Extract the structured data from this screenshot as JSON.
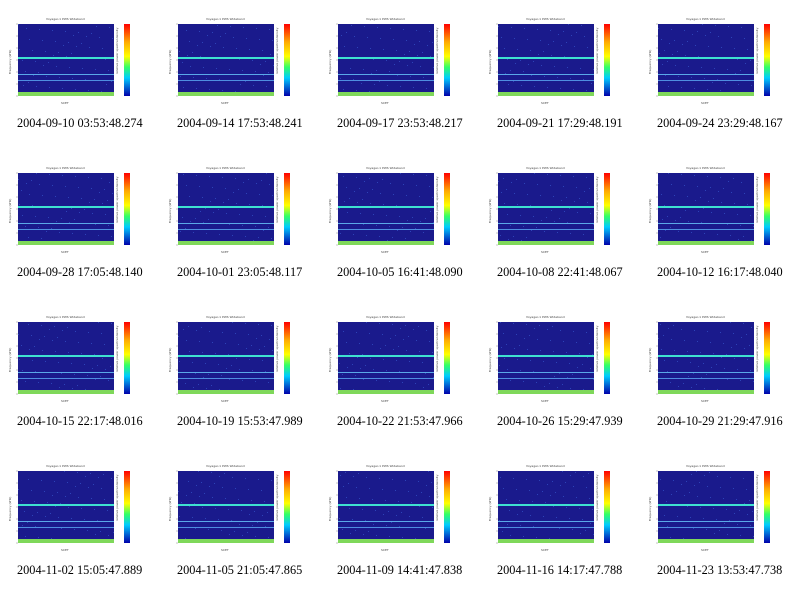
{
  "gallery": {
    "plot_title_template": "Voyager-1 PWS Wideband",
    "ylabel": "Frequency (kHz)",
    "colorbar_label": "relative power spectral density",
    "xaxis_units": "SCET",
    "colors": {
      "plot_background": "#1a1a8c",
      "band_cyan": "#3fe0d0",
      "floor_green": "#7fd85a",
      "colorbar_high": "#ff0000",
      "colorbar_low": "#0000aa"
    },
    "items": [
      {
        "caption": "2004-09-10 03:53:48.274"
      },
      {
        "caption": "2004-09-14 17:53:48.241"
      },
      {
        "caption": "2004-09-17 23:53:48.217"
      },
      {
        "caption": "2004-09-21 17:29:48.191"
      },
      {
        "caption": "2004-09-24 23:29:48.167"
      },
      {
        "caption": "2004-09-28 17:05:48.140"
      },
      {
        "caption": "2004-10-01 23:05:48.117"
      },
      {
        "caption": "2004-10-05 16:41:48.090"
      },
      {
        "caption": "2004-10-08 22:41:48.067"
      },
      {
        "caption": "2004-10-12 16:17:48.040"
      },
      {
        "caption": "2004-10-15 22:17:48.016"
      },
      {
        "caption": "2004-10-19 15:53:47.989"
      },
      {
        "caption": "2004-10-22 21:53:47.966"
      },
      {
        "caption": "2004-10-26 15:29:47.939"
      },
      {
        "caption": "2004-10-29 21:29:47.916"
      },
      {
        "caption": "2004-11-02 15:05:47.889"
      },
      {
        "caption": "2004-11-05 21:05:47.865"
      },
      {
        "caption": "2004-11-09 14:41:47.838"
      },
      {
        "caption": "2004-11-16 14:17:47.788"
      },
      {
        "caption": "2004-11-23 13:53:47.738"
      }
    ]
  }
}
